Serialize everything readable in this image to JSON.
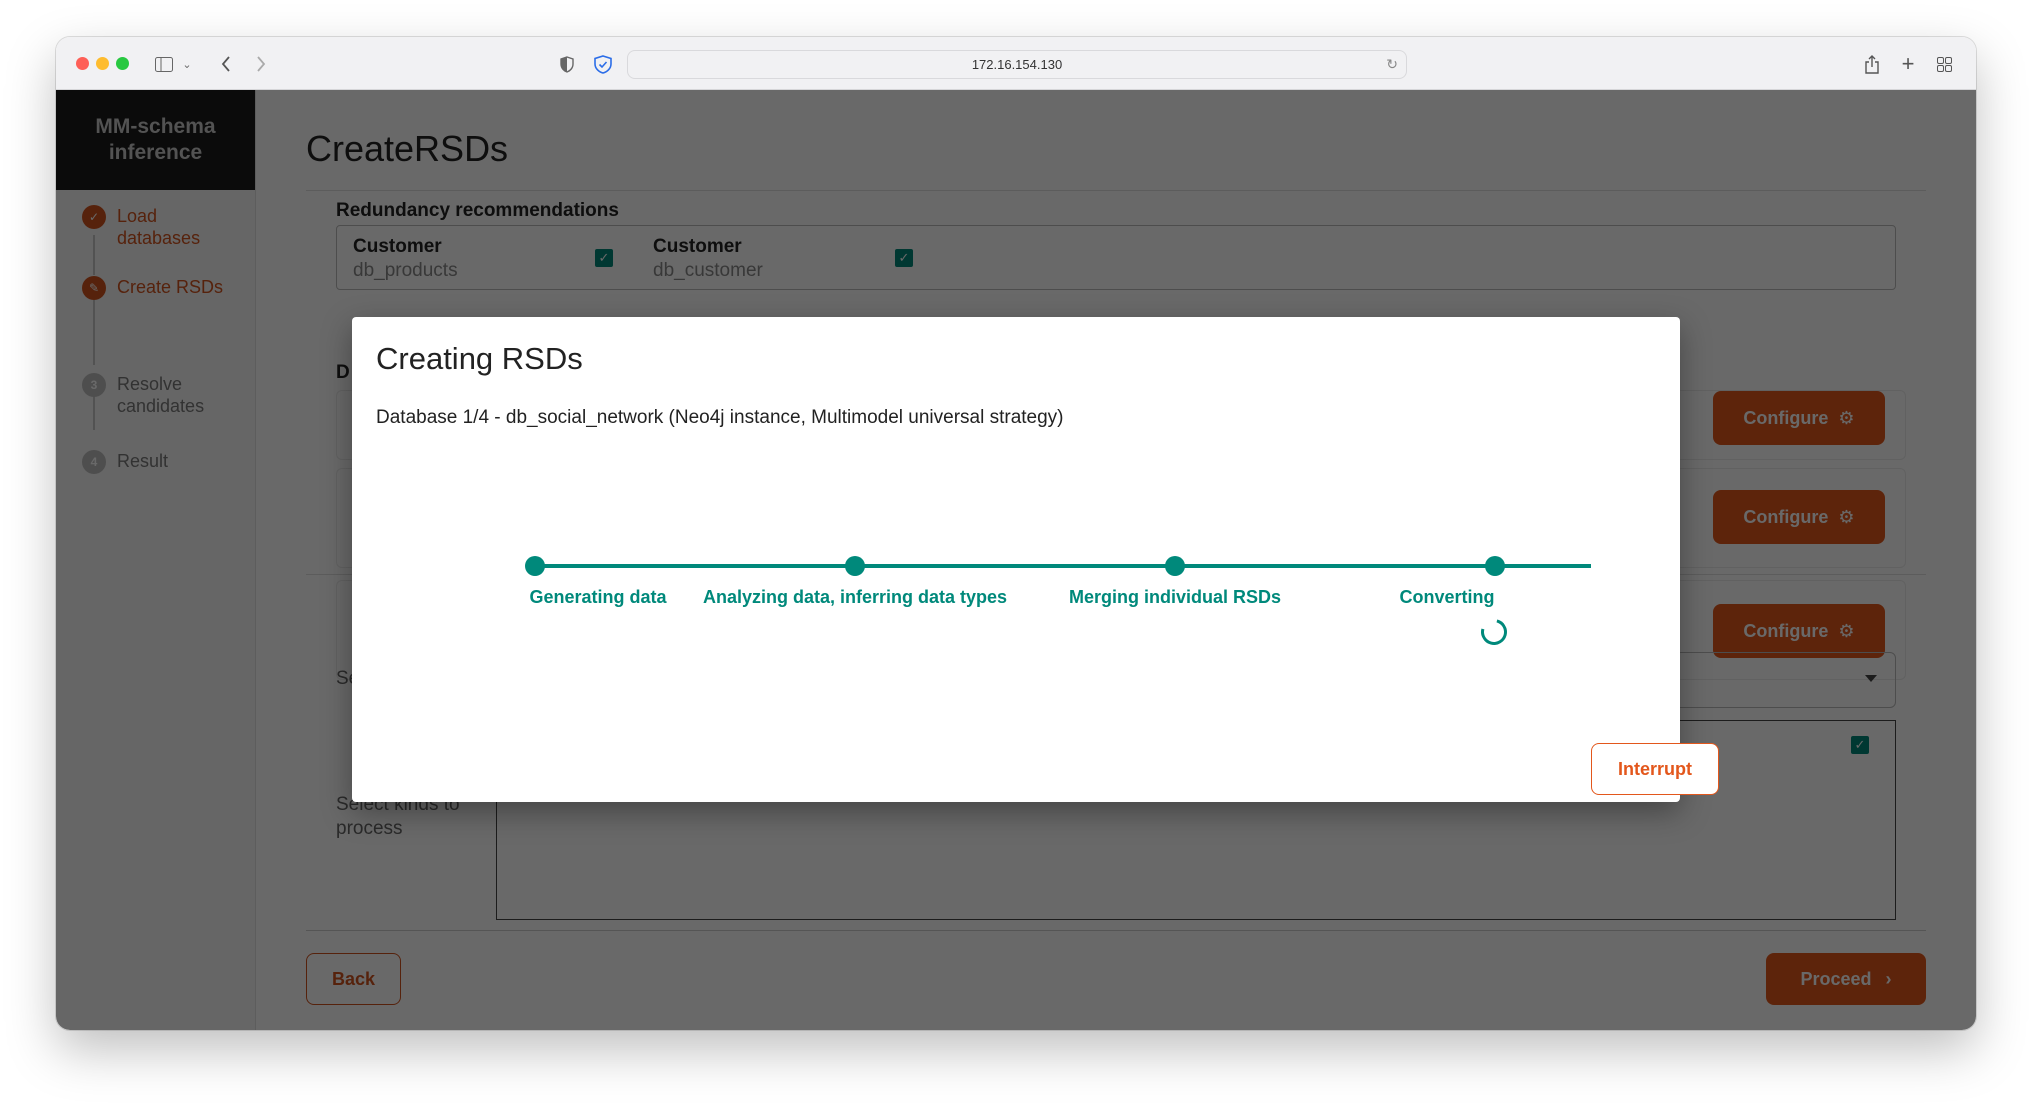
{
  "browser": {
    "url": "172.16.154.130",
    "icons": [
      "sidebar-toggle-icon",
      "chevron-down-icon",
      "back-icon",
      "forward-icon",
      "privacy-shield-icon",
      "security-badge-icon",
      "reload-icon",
      "share-icon",
      "new-tab-icon",
      "tab-overview-icon"
    ]
  },
  "sidebar": {
    "brand": "MM-schema inference",
    "steps": [
      {
        "label": "Load databases",
        "state": "done",
        "icon": "check"
      },
      {
        "label": "Create RSDs",
        "state": "active",
        "icon": "pencil"
      },
      {
        "label": "Resolve candidates",
        "state": "todo",
        "number": "3"
      },
      {
        "label": "Result",
        "state": "todo",
        "number": "4"
      }
    ]
  },
  "page": {
    "title": "CreateRSDs",
    "redundancy_label": "Redundancy recommendations",
    "redundancy_items": [
      {
        "name": "Customer",
        "db": "db_products",
        "checked": true
      },
      {
        "name": "Customer",
        "db": "db_customer",
        "checked": true
      }
    ],
    "databases_label": "D",
    "configure_label": "Configure",
    "select_label": "Se",
    "select_kinds_label": "Select kinds to process",
    "back_label": "Back",
    "proceed_label": "Proceed"
  },
  "modal": {
    "title": "Creating RSDs",
    "subtitle": "Database 1/4 - db_social_network (Neo4j instance, Multimodel universal strategy)",
    "steps": [
      {
        "label": "Generating data",
        "status": "done"
      },
      {
        "label": "Analyzing data, inferring data types",
        "status": "done"
      },
      {
        "label": "Merging individual RSDs",
        "status": "done"
      },
      {
        "label": "Converting",
        "status": "in-progress"
      }
    ],
    "interrupt_label": "Interrupt"
  },
  "colors": {
    "accent": "#e3571c",
    "teal": "#00897b",
    "brand_bg": "#1c1c1c"
  }
}
